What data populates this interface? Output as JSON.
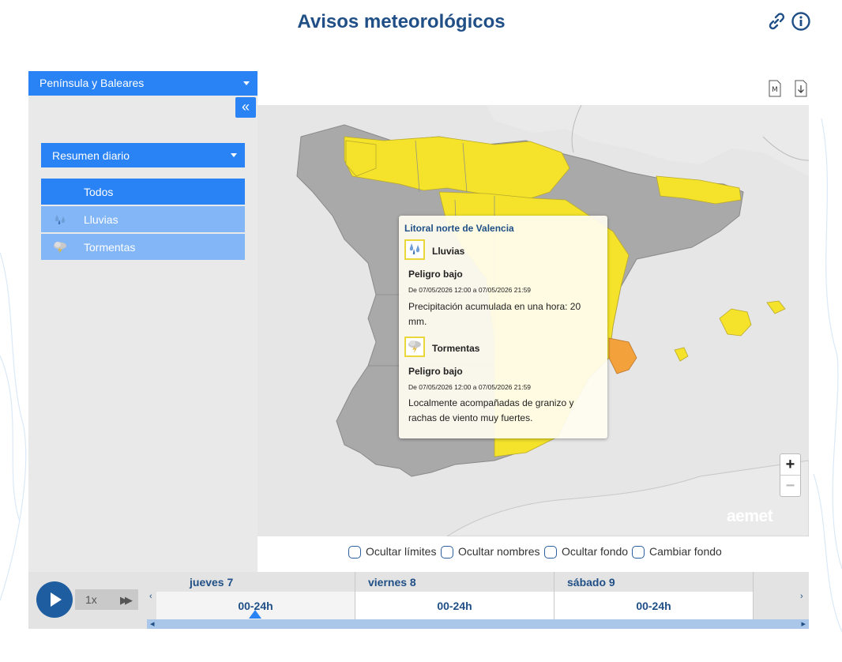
{
  "page": {
    "title": "Avisos meteorológicos",
    "link_icon": "link-icon",
    "info_icon": "info-icon"
  },
  "sidebar": {
    "region_select": "Península y Baleares",
    "collapse_label": "«",
    "mode_select": "Resumen diario",
    "filters": [
      {
        "label": "Todos",
        "active": true,
        "icon": ""
      },
      {
        "label": "Lluvias",
        "active": false,
        "icon": "rain-icon"
      },
      {
        "label": "Tormentas",
        "active": false,
        "icon": "storm-icon"
      }
    ]
  },
  "map": {
    "tools": [
      "map-format-icon",
      "download-icon"
    ],
    "zoom_in": "+",
    "zoom_out": "−",
    "logo": "aemet",
    "colors": {
      "warning_yellow": "#f4e32a",
      "warning_orange": "#f2a13b",
      "no_warning": "#a9a9a9",
      "sea": "#e6e6e6"
    }
  },
  "popup": {
    "zone": "Litoral norte de Valencia",
    "warnings": [
      {
        "name": "Lluvias",
        "icon": "rain-icon",
        "level": "Peligro bajo",
        "dates": "De 07/05/2026 12:00 a 07/05/2026 21:59",
        "description": "Precipitación acumulada en una hora: 20 mm."
      },
      {
        "name": "Tormentas",
        "icon": "storm-icon",
        "level": "Peligro bajo",
        "dates": "De 07/05/2026 12:00 a 07/05/2026 21:59",
        "description": "Localmente acompañadas de granizo y rachas de viento muy fuertes."
      }
    ]
  },
  "toggles": [
    "Ocultar límites",
    "Ocultar nombres",
    "Ocultar fondo",
    "Cambiar fondo"
  ],
  "timeline": {
    "speed": "1x",
    "days": [
      {
        "label": "jueves 7",
        "slot": "00-24h",
        "selected": true
      },
      {
        "label": "viernes 8",
        "slot": "00-24h",
        "selected": false
      },
      {
        "label": "sábado 9",
        "slot": "00-24h",
        "selected": false
      }
    ]
  }
}
